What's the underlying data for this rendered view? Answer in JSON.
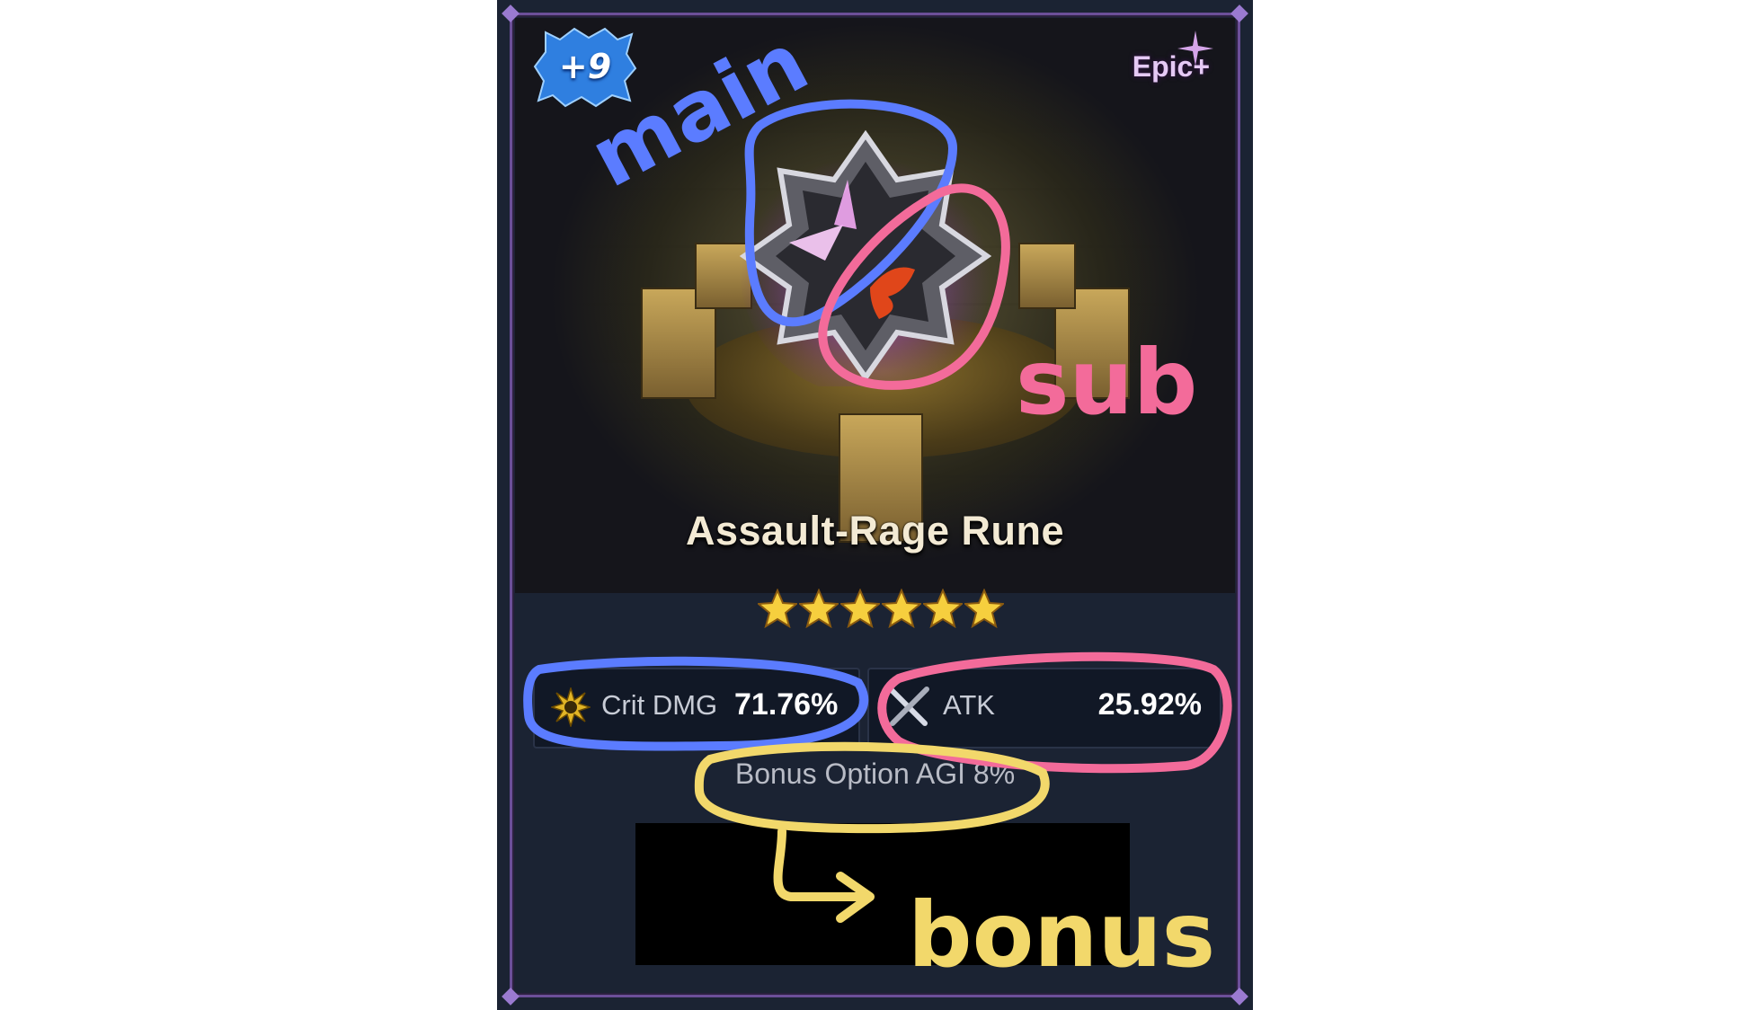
{
  "card": {
    "level_badge": "+9",
    "grade": "Epic+",
    "rune_name": "Assault-Rage Rune",
    "stars": 6,
    "main_stat": {
      "label": "Crit DMG",
      "value": "71.76%",
      "icon": "burst-icon"
    },
    "sub_stat": {
      "label": "ATK",
      "value": "25.92%",
      "icon": "crossed-swords-icon"
    },
    "bonus_option": "Bonus Option AGI 8%"
  },
  "annotations": {
    "main": "main",
    "sub": "sub",
    "bonus": "bonus",
    "colors": {
      "main": "#5b7cff",
      "sub": "#f36b9a",
      "bonus": "#f2d86b"
    }
  },
  "colors": {
    "frame": "#6c4f99",
    "badge": "#2f7fe0",
    "grade": "#e5c9f5"
  }
}
